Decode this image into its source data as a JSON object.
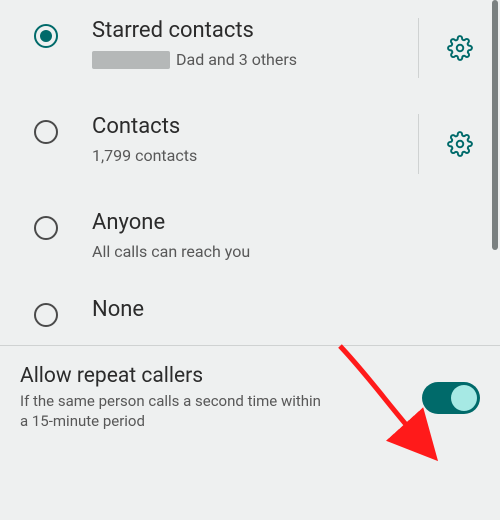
{
  "options": [
    {
      "id": "starred",
      "label": "Starred contacts",
      "sub_trail": "Dad and 3 others",
      "selected": true,
      "has_settings": true,
      "has_redact": true
    },
    {
      "id": "contacts",
      "label": "Contacts",
      "sub": "1,799 contacts",
      "selected": false,
      "has_settings": true
    },
    {
      "id": "anyone",
      "label": "Anyone",
      "sub": "All calls can reach you",
      "selected": false,
      "has_settings": false
    },
    {
      "id": "none",
      "label": "None",
      "selected": false,
      "has_settings": false
    }
  ],
  "repeat": {
    "title": "Allow repeat callers",
    "sub": "If the same person calls a second time within a 15-minute period",
    "on": true
  },
  "colors": {
    "accent": "#006a6a"
  }
}
